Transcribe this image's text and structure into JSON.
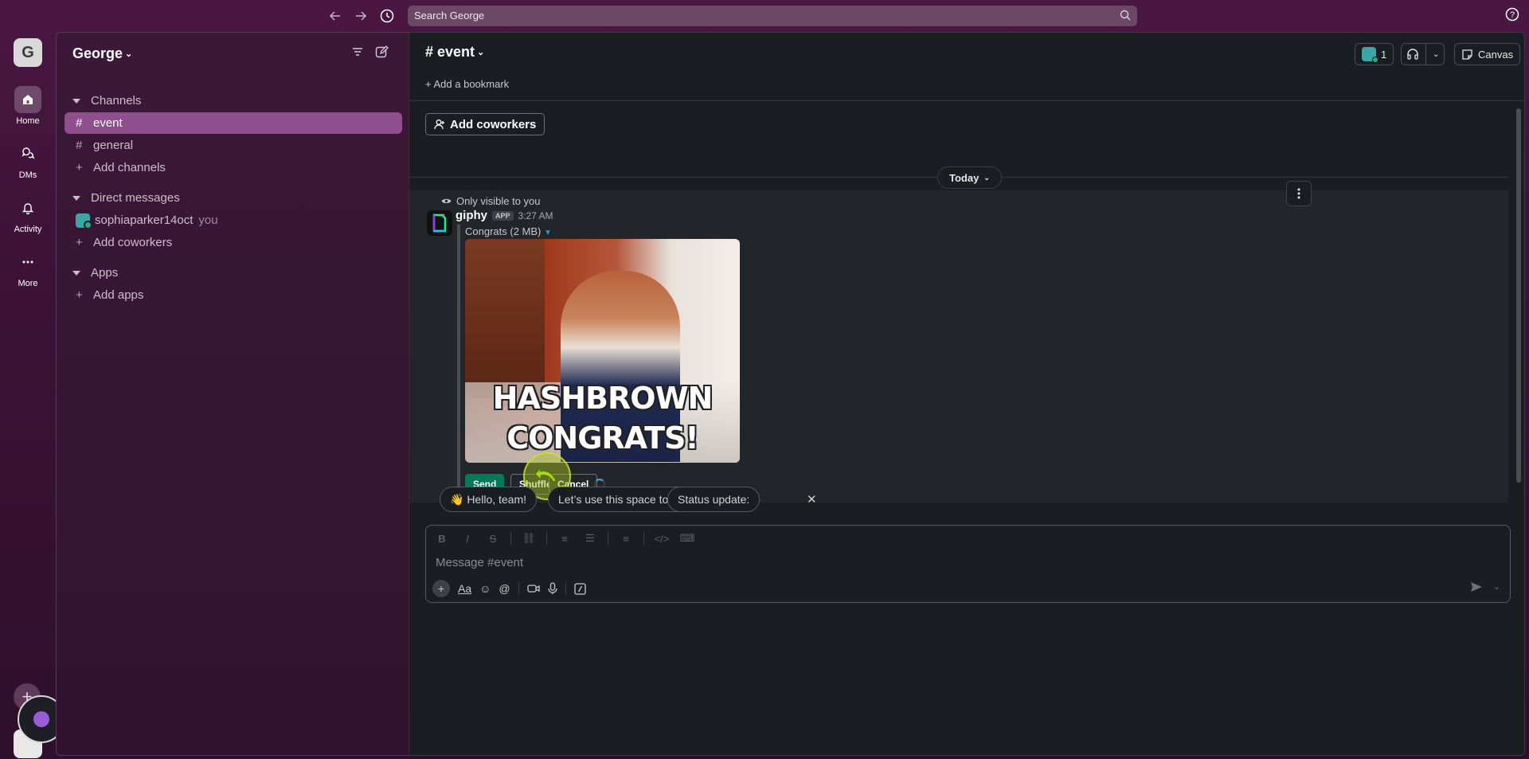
{
  "search": {
    "placeholder": "Search George"
  },
  "workspace": {
    "initial": "G",
    "name": "George"
  },
  "rail": {
    "items": [
      {
        "label": "Home",
        "icon": "home-icon"
      },
      {
        "label": "DMs",
        "icon": "dms-icon"
      },
      {
        "label": "Activity",
        "icon": "bell-icon"
      },
      {
        "label": "More",
        "icon": "more-icon"
      }
    ],
    "add": "+"
  },
  "sidebar": {
    "channels_header": "Channels",
    "channels": [
      {
        "label": "event",
        "active": true
      },
      {
        "label": "general",
        "active": false
      }
    ],
    "add_channels": "Add channels",
    "dm_header": "Direct messages",
    "dm_user": "sophiaparker14oct",
    "dm_you": "you",
    "add_coworkers": "Add coworkers",
    "apps_header": "Apps",
    "add_apps": "Add apps"
  },
  "channel": {
    "name": "event",
    "bookmark": "Add a bookmark",
    "member_count": "1",
    "canvas": "Canvas"
  },
  "main": {
    "add_coworkers": "Add coworkers",
    "today": "Today",
    "only_visible": "Only visible to you",
    "sender": "giphy",
    "app_badge": "APP",
    "time": "3:27 AM",
    "gif_title": "Congrats (2 MB)",
    "gif_text_1": "HASHBROWN",
    "gif_text_2": "CONGRATS!",
    "send": "Send",
    "shuffle": "Shuffle",
    "cancel": "Cancel"
  },
  "suggestions": [
    "👋 Hello, team!",
    "Let’s use this space to…",
    "Status update:"
  ],
  "composer": {
    "placeholder": "Message #event"
  },
  "colors": {
    "accent": "#8e4f8c",
    "send": "#007a5a",
    "brand": "#4a1742"
  }
}
